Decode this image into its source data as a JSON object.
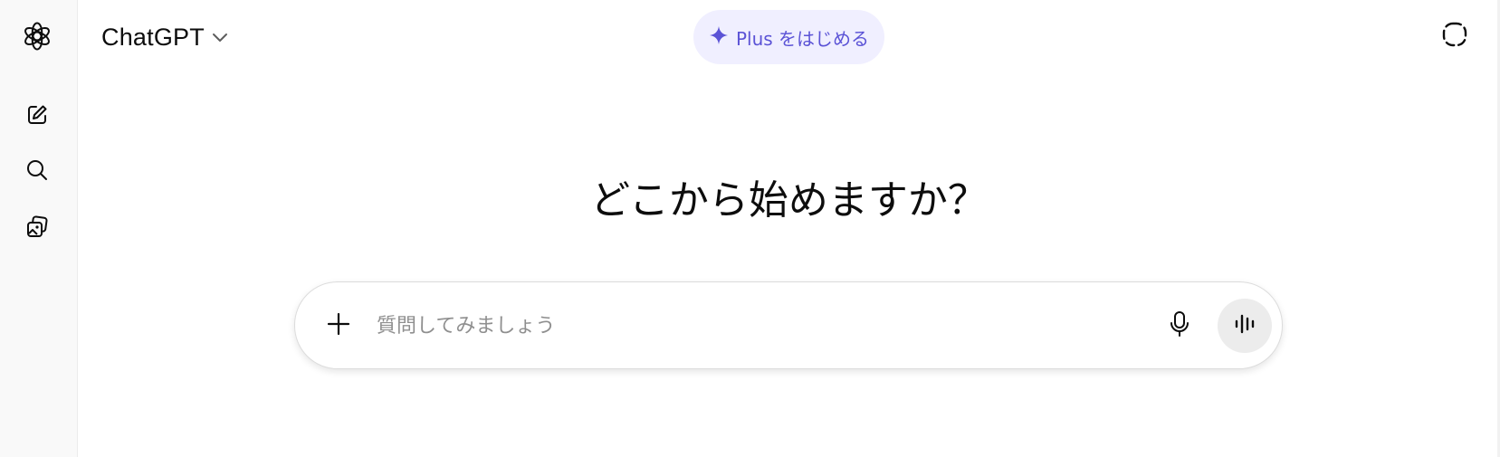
{
  "app": {
    "title": "ChatGPT"
  },
  "sidebar": {
    "items": [
      {
        "name": "logo",
        "icon": "openai-logo-icon"
      },
      {
        "name": "new-chat",
        "icon": "compose-icon"
      },
      {
        "name": "search",
        "icon": "search-icon"
      },
      {
        "name": "library",
        "icon": "images-icon"
      }
    ]
  },
  "header": {
    "model_label": "ChatGPT",
    "model_icon": "chevron-down-icon",
    "upgrade_label": "Plus をはじめる",
    "upgrade_icon": "sparkle-icon",
    "temp_chat_icon": "dashed-circle-icon"
  },
  "main": {
    "headline": "どこから始めますか？"
  },
  "composer": {
    "placeholder": "質問してみましょう",
    "value": "",
    "attach_icon": "plus-icon",
    "dictate_icon": "microphone-icon",
    "voice_icon": "voice-mode-icon"
  },
  "colors": {
    "accent": "#5b53d6",
    "upgrade_bg": "#f0efff",
    "sidebar_bg": "#f9f9f9",
    "text": "#0d0d0d",
    "placeholder": "#8f8f8f",
    "voice_btn_bg": "#ececec"
  }
}
